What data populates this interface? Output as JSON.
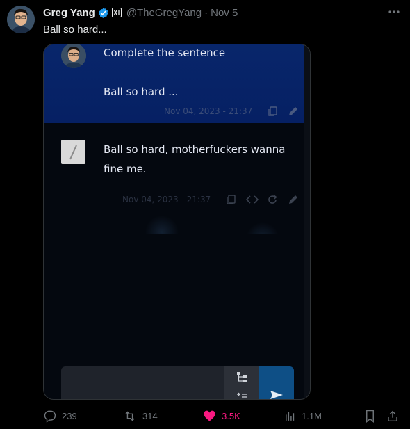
{
  "author": {
    "name": "Greg Yang",
    "handle": "@TheGregYang",
    "date": "Nov 5",
    "affiliation_badge": "xAI"
  },
  "tweet_text": "Ball so hard...",
  "media": {
    "prompt_line1": "Complete the sentence",
    "prompt_line2": "Ball so hard ...",
    "prompt_timestamp": "Nov 04, 2023 - 21:37",
    "reply_line1": "Ball so hard, motherfuckers wanna",
    "reply_line2": "fine me.",
    "reply_timestamp": "Nov 04, 2023 - 21:37"
  },
  "stats": {
    "replies": "239",
    "retweets": "314",
    "likes": "3.5K",
    "views": "1.1M"
  },
  "colors": {
    "verified": "#1d9bf0",
    "like": "#f91880",
    "user_message_bg": "#062063",
    "send_button": "#0e4f86"
  },
  "icons": {
    "more": "more-icon",
    "reply": "reply-icon",
    "retweet": "retweet-icon",
    "like": "heart-icon",
    "views": "views-icon",
    "bookmark": "bookmark-icon",
    "share": "share-icon"
  }
}
